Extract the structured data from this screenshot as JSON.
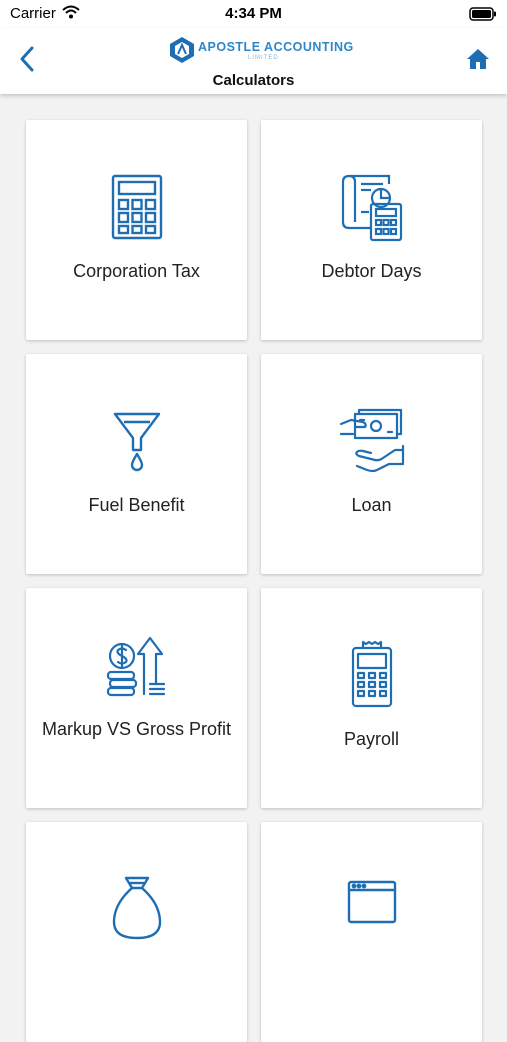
{
  "status_bar": {
    "carrier": "Carrier",
    "time": "4:34 PM"
  },
  "nav": {
    "logo_text": "APOSTLE ACCOUNTING",
    "logo_sub": "LIMITED",
    "title": "Calculators"
  },
  "theme": {
    "accent": "#1f6eb4",
    "card_bg": "#ffffff",
    "page_bg": "#f2f2f2"
  },
  "calculators": [
    {
      "label": "Corporation Tax",
      "icon": "calculator-icon"
    },
    {
      "label": "Debtor Days",
      "icon": "document-calculator-icon"
    },
    {
      "label": "Fuel Benefit",
      "icon": "funnel-drop-icon"
    },
    {
      "label": "Loan",
      "icon": "cash-hand-icon"
    },
    {
      "label": "Markup VS Gross Profit",
      "icon": "dollar-coins-arrow-icon"
    },
    {
      "label": "Payroll",
      "icon": "payment-terminal-icon"
    },
    {
      "label": "",
      "icon": "money-bag-icon"
    },
    {
      "label": "",
      "icon": "browser-window-icon"
    }
  ]
}
